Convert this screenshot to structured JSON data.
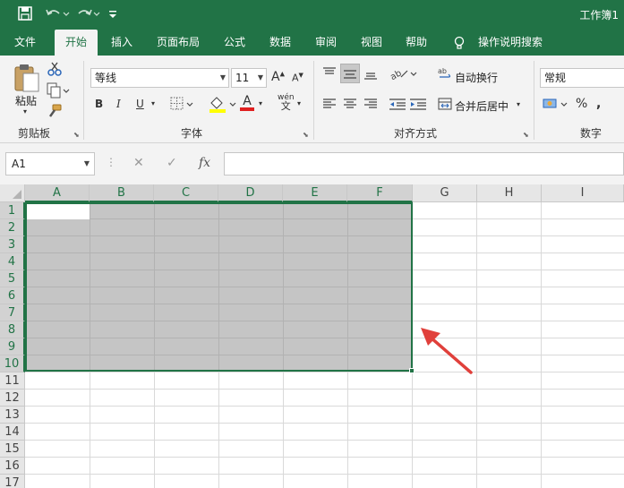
{
  "window": {
    "title": "工作簿1"
  },
  "tabs": [
    {
      "label": "文件",
      "active": false
    },
    {
      "label": "开始",
      "active": true
    },
    {
      "label": "插入",
      "active": false
    },
    {
      "label": "页面布局",
      "active": false
    },
    {
      "label": "公式",
      "active": false
    },
    {
      "label": "数据",
      "active": false
    },
    {
      "label": "审阅",
      "active": false
    },
    {
      "label": "视图",
      "active": false
    },
    {
      "label": "帮助",
      "active": false
    }
  ],
  "tell_me": "操作说明搜索",
  "ribbon": {
    "clipboard": {
      "paste_label": "粘贴",
      "group_label": "剪贴板"
    },
    "font": {
      "font_name": "等线",
      "font_size": "11",
      "bold": "B",
      "italic": "I",
      "underline": "U",
      "font_color_glyph": "A",
      "phonetic_top": "wén",
      "phonetic_bottom": "文",
      "group_label": "字体"
    },
    "alignment": {
      "wrap_text": "自动换行",
      "merge_center": "合并后居中",
      "group_label": "对齐方式"
    },
    "number": {
      "format": "常规",
      "percent": "%",
      "group_label": "数字"
    }
  },
  "formula_bar": {
    "name_box": "A1",
    "fx": "fx",
    "value": ""
  },
  "grid": {
    "columns": [
      "A",
      "B",
      "C",
      "D",
      "E",
      "F",
      "G",
      "H",
      "I"
    ],
    "rows": [
      "1",
      "2",
      "3",
      "4",
      "5",
      "6",
      "7",
      "8",
      "9",
      "10",
      "11",
      "12",
      "13",
      "14",
      "15",
      "16",
      "17"
    ],
    "selected_range": "A1:F10"
  },
  "colors": {
    "accent": "#217346",
    "annotation_arrow": "#e0403b"
  }
}
